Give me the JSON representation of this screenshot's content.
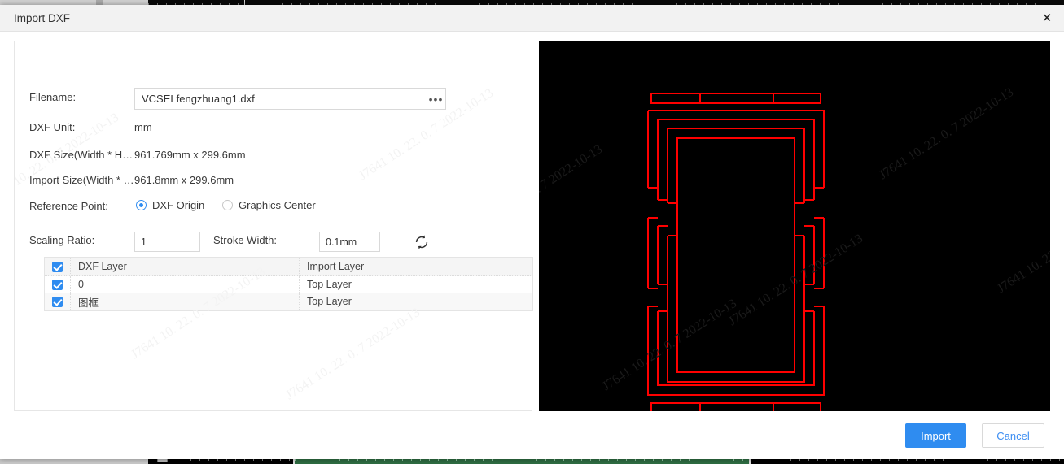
{
  "window": {
    "title": "Import DXF",
    "close_icon": "close-icon"
  },
  "form": {
    "filename": {
      "label": "Filename:",
      "value": "VCSELfengzhuang1.dxf",
      "placeholder": "",
      "browse_label": "•••"
    },
    "dxf_unit": {
      "label": "DXF Unit:",
      "value": "mm"
    },
    "dxf_size": {
      "label": "DXF Size(Width * H…",
      "value": "961.769mm x 299.6mm"
    },
    "import_size": {
      "label": "Import Size(Width * …",
      "value": "961.8mm x 299.6mm"
    },
    "reference_point": {
      "label": "Reference Point:",
      "options": [
        {
          "label": "DXF Origin",
          "selected": true
        },
        {
          "label": "Graphics Center",
          "selected": false
        }
      ]
    },
    "scaling_ratio": {
      "label": "Scaling Ratio:",
      "value": "1"
    },
    "stroke_width": {
      "label": "Stroke Width:",
      "value": "0.1mm"
    },
    "refresh_icon": "refresh-icon"
  },
  "layer_table": {
    "columns": [
      "DXF Layer",
      "Import Layer"
    ],
    "header_checked": true,
    "rows": [
      {
        "checked": true,
        "dxf_layer": "0",
        "import_layer": "Top Layer"
      },
      {
        "checked": true,
        "dxf_layer": "图框",
        "import_layer": "Top Layer"
      }
    ]
  },
  "footer": {
    "import_label": "Import",
    "cancel_label": "Cancel"
  },
  "colors": {
    "accent": "#2f8cf0",
    "preview_bg": "#000000",
    "drawing_stroke": "#ff0000",
    "titlebar": "#f2f2f2",
    "green_ruler": "#2d6b41"
  },
  "watermark": {
    "text": "J7641  10. 22. 0. 7  2022-10-13"
  }
}
